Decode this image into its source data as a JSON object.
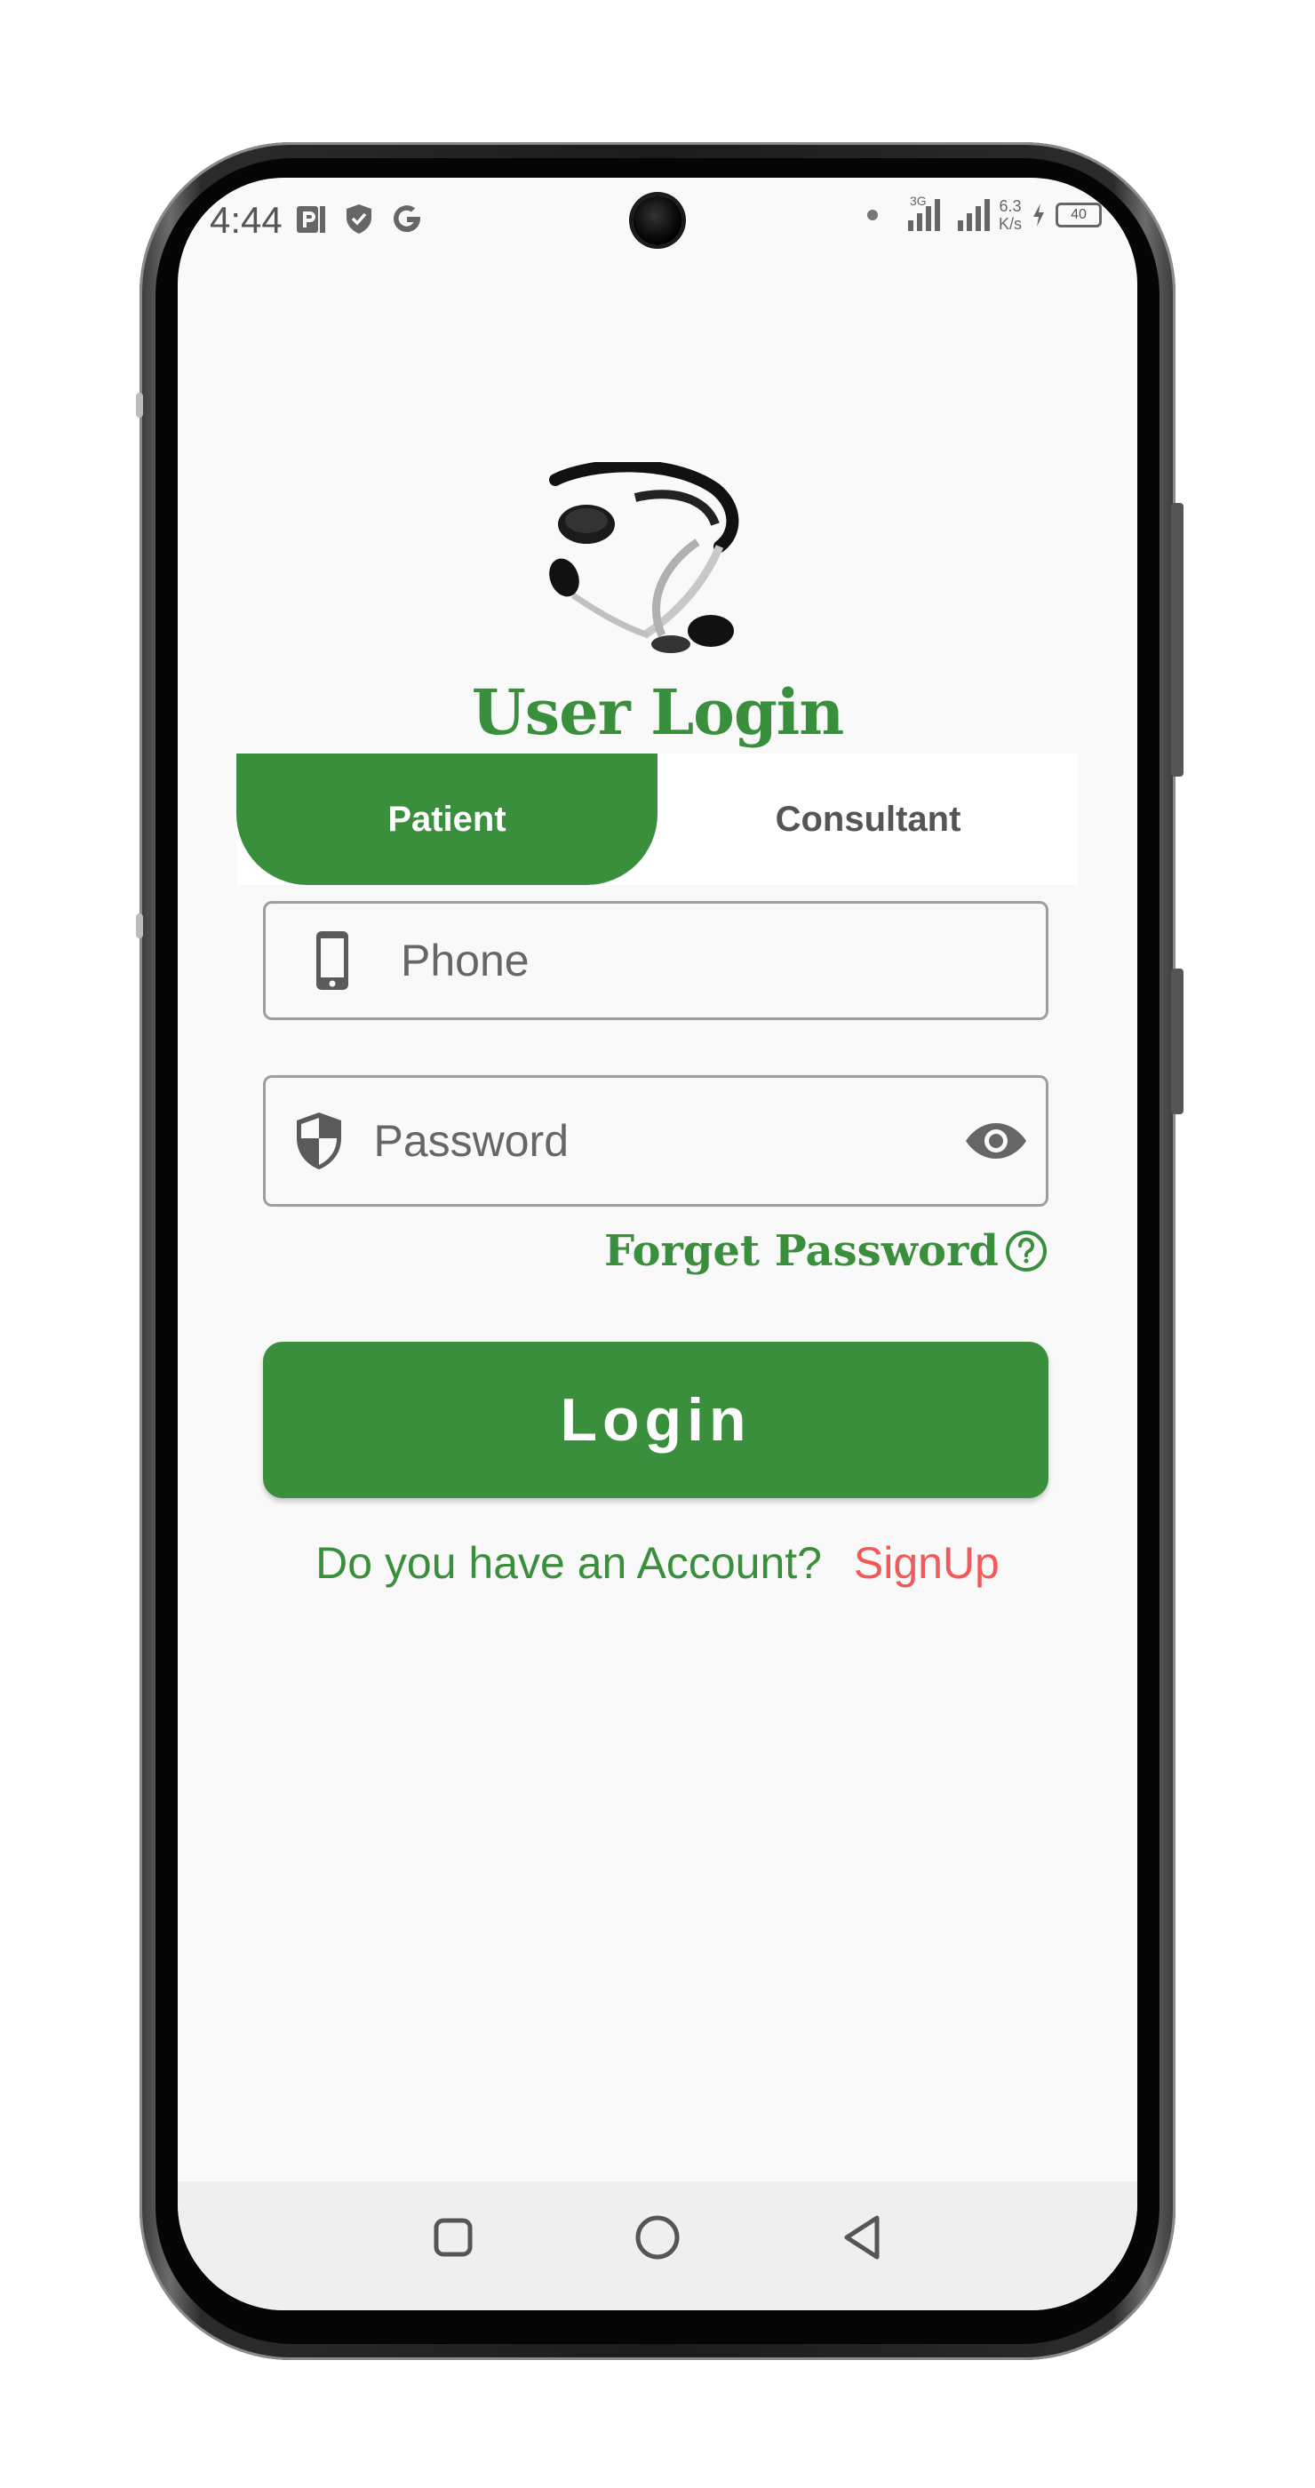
{
  "status_bar": {
    "time": "4:44",
    "network_type": "3G",
    "speed_value": "6.3",
    "speed_unit": "K/s",
    "battery": "40"
  },
  "header": {
    "logo_icon": "stethoscope-icon",
    "title": "User Login"
  },
  "tabs": [
    {
      "label": "Patient",
      "active": true
    },
    {
      "label": "Consultant",
      "active": false
    }
  ],
  "form": {
    "phone_placeholder": "Phone",
    "phone_value": "",
    "phone_icon": "phone-icon",
    "password_placeholder": "Password",
    "password_value": "",
    "password_icon": "shield-icon",
    "visibility_icon": "eye-icon",
    "forget_password": "Forget Password",
    "forget_icon": "help-circle-icon",
    "login_label": "Login"
  },
  "footer": {
    "account_question": "Do you have an Account?",
    "signup_label": "SignUp"
  },
  "colors": {
    "primary": "#3a8f3c",
    "signup": "#f05a5a",
    "background": "#f9f9f9"
  }
}
